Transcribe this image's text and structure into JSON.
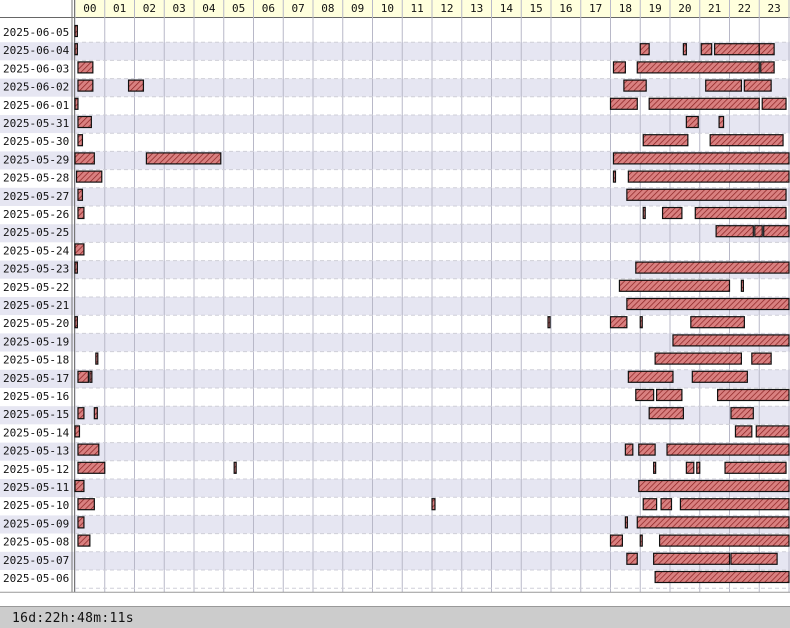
{
  "chart_data": {
    "type": "timeline",
    "x_unit": "hour",
    "x_ticks": [
      "00",
      "01",
      "02",
      "03",
      "04",
      "05",
      "06",
      "07",
      "08",
      "09",
      "10",
      "11",
      "12",
      "13",
      "14",
      "15",
      "16",
      "17",
      "18",
      "19",
      "20",
      "21",
      "22",
      "23"
    ],
    "xlim": [
      0,
      24
    ],
    "grid": true,
    "colors": {
      "bar_fill": "#d98080",
      "bar_hatch": "#8a2020",
      "bar_stroke": "#111111",
      "row_alt": "#e6e6f2",
      "header_bg": "#ffffdd",
      "footer_bg": "#cccccc"
    },
    "rows": [
      {
        "date": "2025-06-05",
        "intervals": [
          [
            0.0,
            0.08
          ]
        ]
      },
      {
        "date": "2025-06-04",
        "intervals": [
          [
            0.0,
            0.08
          ],
          [
            19.0,
            19.3
          ],
          [
            20.45,
            20.55
          ],
          [
            21.05,
            21.4
          ],
          [
            21.5,
            23.0
          ],
          [
            23.0,
            23.5
          ]
        ]
      },
      {
        "date": "2025-06-03",
        "intervals": [
          [
            0.1,
            0.6
          ],
          [
            18.1,
            18.5
          ],
          [
            18.9,
            23.0
          ],
          [
            23.05,
            23.5
          ]
        ]
      },
      {
        "date": "2025-06-02",
        "intervals": [
          [
            0.1,
            0.6
          ],
          [
            1.8,
            2.3
          ],
          [
            18.45,
            19.2
          ],
          [
            21.2,
            22.4
          ],
          [
            22.5,
            23.4
          ]
        ]
      },
      {
        "date": "2025-06-01",
        "intervals": [
          [
            0.0,
            0.1
          ],
          [
            18.0,
            18.9
          ],
          [
            19.3,
            23.0
          ],
          [
            23.1,
            23.9
          ]
        ]
      },
      {
        "date": "2025-05-31",
        "intervals": [
          [
            0.1,
            0.55
          ],
          [
            20.55,
            20.95
          ],
          [
            21.65,
            21.8
          ]
        ]
      },
      {
        "date": "2025-05-30",
        "intervals": [
          [
            0.1,
            0.25
          ],
          [
            19.1,
            20.6
          ],
          [
            21.35,
            23.8
          ]
        ]
      },
      {
        "date": "2025-05-29",
        "intervals": [
          [
            0.0,
            0.65
          ],
          [
            2.4,
            4.9
          ],
          [
            18.1,
            24.0
          ]
        ]
      },
      {
        "date": "2025-05-28",
        "intervals": [
          [
            0.05,
            0.9
          ],
          [
            18.1,
            18.15
          ],
          [
            18.6,
            24.0
          ]
        ]
      },
      {
        "date": "2025-05-27",
        "intervals": [
          [
            0.1,
            0.25
          ],
          [
            18.55,
            23.9
          ]
        ]
      },
      {
        "date": "2025-05-26",
        "intervals": [
          [
            0.1,
            0.3
          ],
          [
            19.1,
            19.15
          ],
          [
            19.75,
            20.4
          ],
          [
            20.85,
            23.9
          ]
        ]
      },
      {
        "date": "2025-05-25",
        "intervals": [
          [
            21.55,
            22.8
          ],
          [
            22.85,
            23.1
          ],
          [
            23.15,
            24.0
          ]
        ]
      },
      {
        "date": "2025-05-24",
        "intervals": [
          [
            0.0,
            0.3
          ]
        ]
      },
      {
        "date": "2025-05-23",
        "intervals": [
          [
            0.0,
            0.08
          ],
          [
            18.85,
            24.0
          ]
        ]
      },
      {
        "date": "2025-05-22",
        "intervals": [
          [
            18.3,
            22.0
          ],
          [
            22.4,
            22.45
          ]
        ]
      },
      {
        "date": "2025-05-21",
        "intervals": [
          [
            18.55,
            24.0
          ]
        ]
      },
      {
        "date": "2025-05-20",
        "intervals": [
          [
            0.0,
            0.08
          ],
          [
            15.9,
            15.95
          ],
          [
            18.0,
            18.55
          ],
          [
            19.0,
            19.05
          ],
          [
            20.7,
            22.5
          ]
        ]
      },
      {
        "date": "2025-05-19",
        "intervals": [
          [
            20.1,
            24.0
          ]
        ]
      },
      {
        "date": "2025-05-18",
        "intervals": [
          [
            0.7,
            0.75
          ],
          [
            19.5,
            22.4
          ],
          [
            22.75,
            23.4
          ]
        ]
      },
      {
        "date": "2025-05-17",
        "intervals": [
          [
            0.1,
            0.45
          ],
          [
            0.5,
            0.55
          ],
          [
            18.6,
            20.1
          ],
          [
            20.75,
            22.6
          ]
        ]
      },
      {
        "date": "2025-05-16",
        "intervals": [
          [
            18.85,
            19.45
          ],
          [
            19.55,
            20.4
          ],
          [
            21.6,
            24.0
          ]
        ]
      },
      {
        "date": "2025-05-15",
        "intervals": [
          [
            0.1,
            0.3
          ],
          [
            0.65,
            0.75
          ],
          [
            19.3,
            20.45
          ],
          [
            22.05,
            22.8
          ]
        ]
      },
      {
        "date": "2025-05-14",
        "intervals": [
          [
            0.0,
            0.15
          ],
          [
            22.2,
            22.75
          ],
          [
            22.9,
            24.0
          ]
        ]
      },
      {
        "date": "2025-05-13",
        "intervals": [
          [
            0.1,
            0.8
          ],
          [
            18.5,
            18.75
          ],
          [
            18.95,
            19.5
          ],
          [
            19.9,
            24.0
          ]
        ]
      },
      {
        "date": "2025-05-12",
        "intervals": [
          [
            0.1,
            1.0
          ],
          [
            5.35,
            5.4
          ],
          [
            19.45,
            19.5
          ],
          [
            20.55,
            20.8
          ],
          [
            20.9,
            21.0
          ],
          [
            21.85,
            23.9
          ]
        ]
      },
      {
        "date": "2025-05-11",
        "intervals": [
          [
            0.0,
            0.3
          ],
          [
            18.95,
            24.0
          ]
        ]
      },
      {
        "date": "2025-05-10",
        "intervals": [
          [
            0.1,
            0.65
          ],
          [
            12.0,
            12.1
          ],
          [
            19.1,
            19.55
          ],
          [
            19.7,
            20.05
          ],
          [
            20.35,
            24.0
          ]
        ]
      },
      {
        "date": "2025-05-09",
        "intervals": [
          [
            0.1,
            0.3
          ],
          [
            18.5,
            18.55
          ],
          [
            18.9,
            24.0
          ]
        ]
      },
      {
        "date": "2025-05-08",
        "intervals": [
          [
            0.1,
            0.5
          ],
          [
            18.0,
            18.4
          ],
          [
            19.0,
            19.05
          ],
          [
            19.65,
            24.0
          ]
        ]
      },
      {
        "date": "2025-05-07",
        "intervals": [
          [
            18.55,
            18.9
          ],
          [
            19.45,
            22.0
          ],
          [
            22.05,
            23.6
          ]
        ]
      },
      {
        "date": "2025-05-06",
        "intervals": [
          [
            19.5,
            24.0
          ]
        ]
      }
    ]
  },
  "footer": {
    "elapsed": "16d:22h:48m:11s"
  }
}
